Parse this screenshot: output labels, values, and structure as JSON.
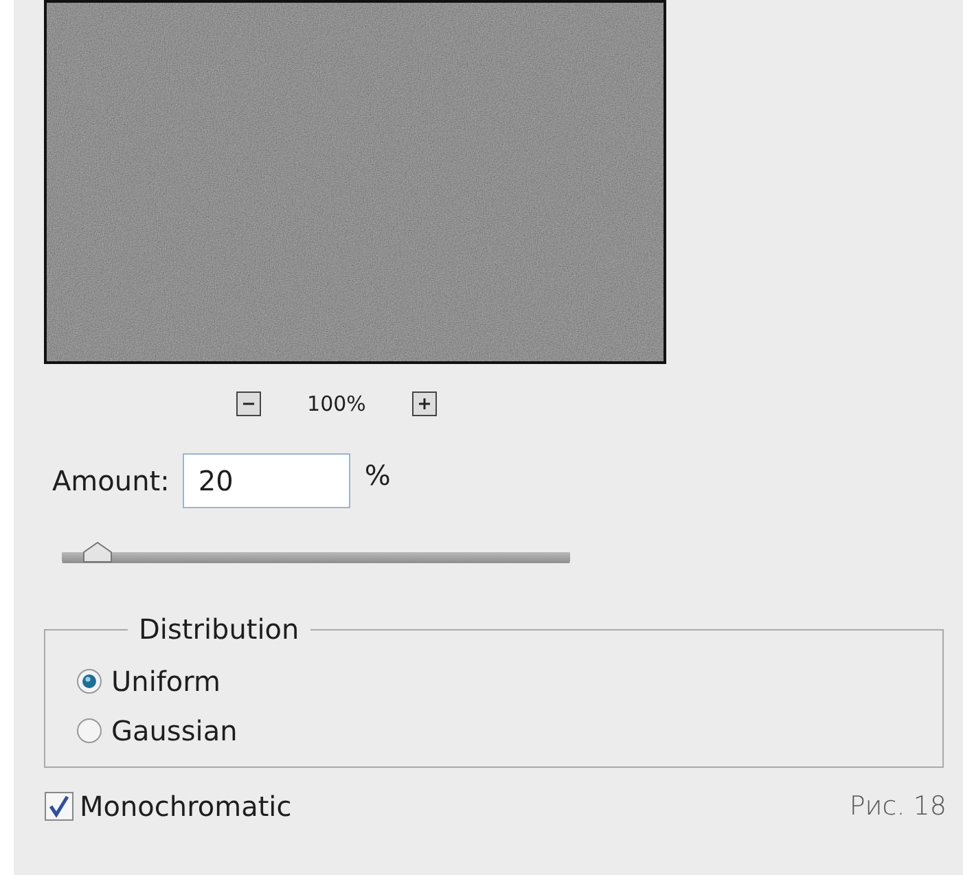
{
  "preview": {
    "kind": "picture",
    "zoom": "100%"
  },
  "amount": {
    "label": "Amount:",
    "value": "20",
    "unit": "%",
    "level": 0.05
  },
  "distribution": {
    "title": "Distribution",
    "options": [
      {
        "label": "Uniform",
        "selected": true
      },
      {
        "label": "Gaussian",
        "selected": false
      }
    ]
  },
  "monochromatic": {
    "label": "Monochromatic",
    "checked": true
  },
  "caption": "Рис. 18"
}
